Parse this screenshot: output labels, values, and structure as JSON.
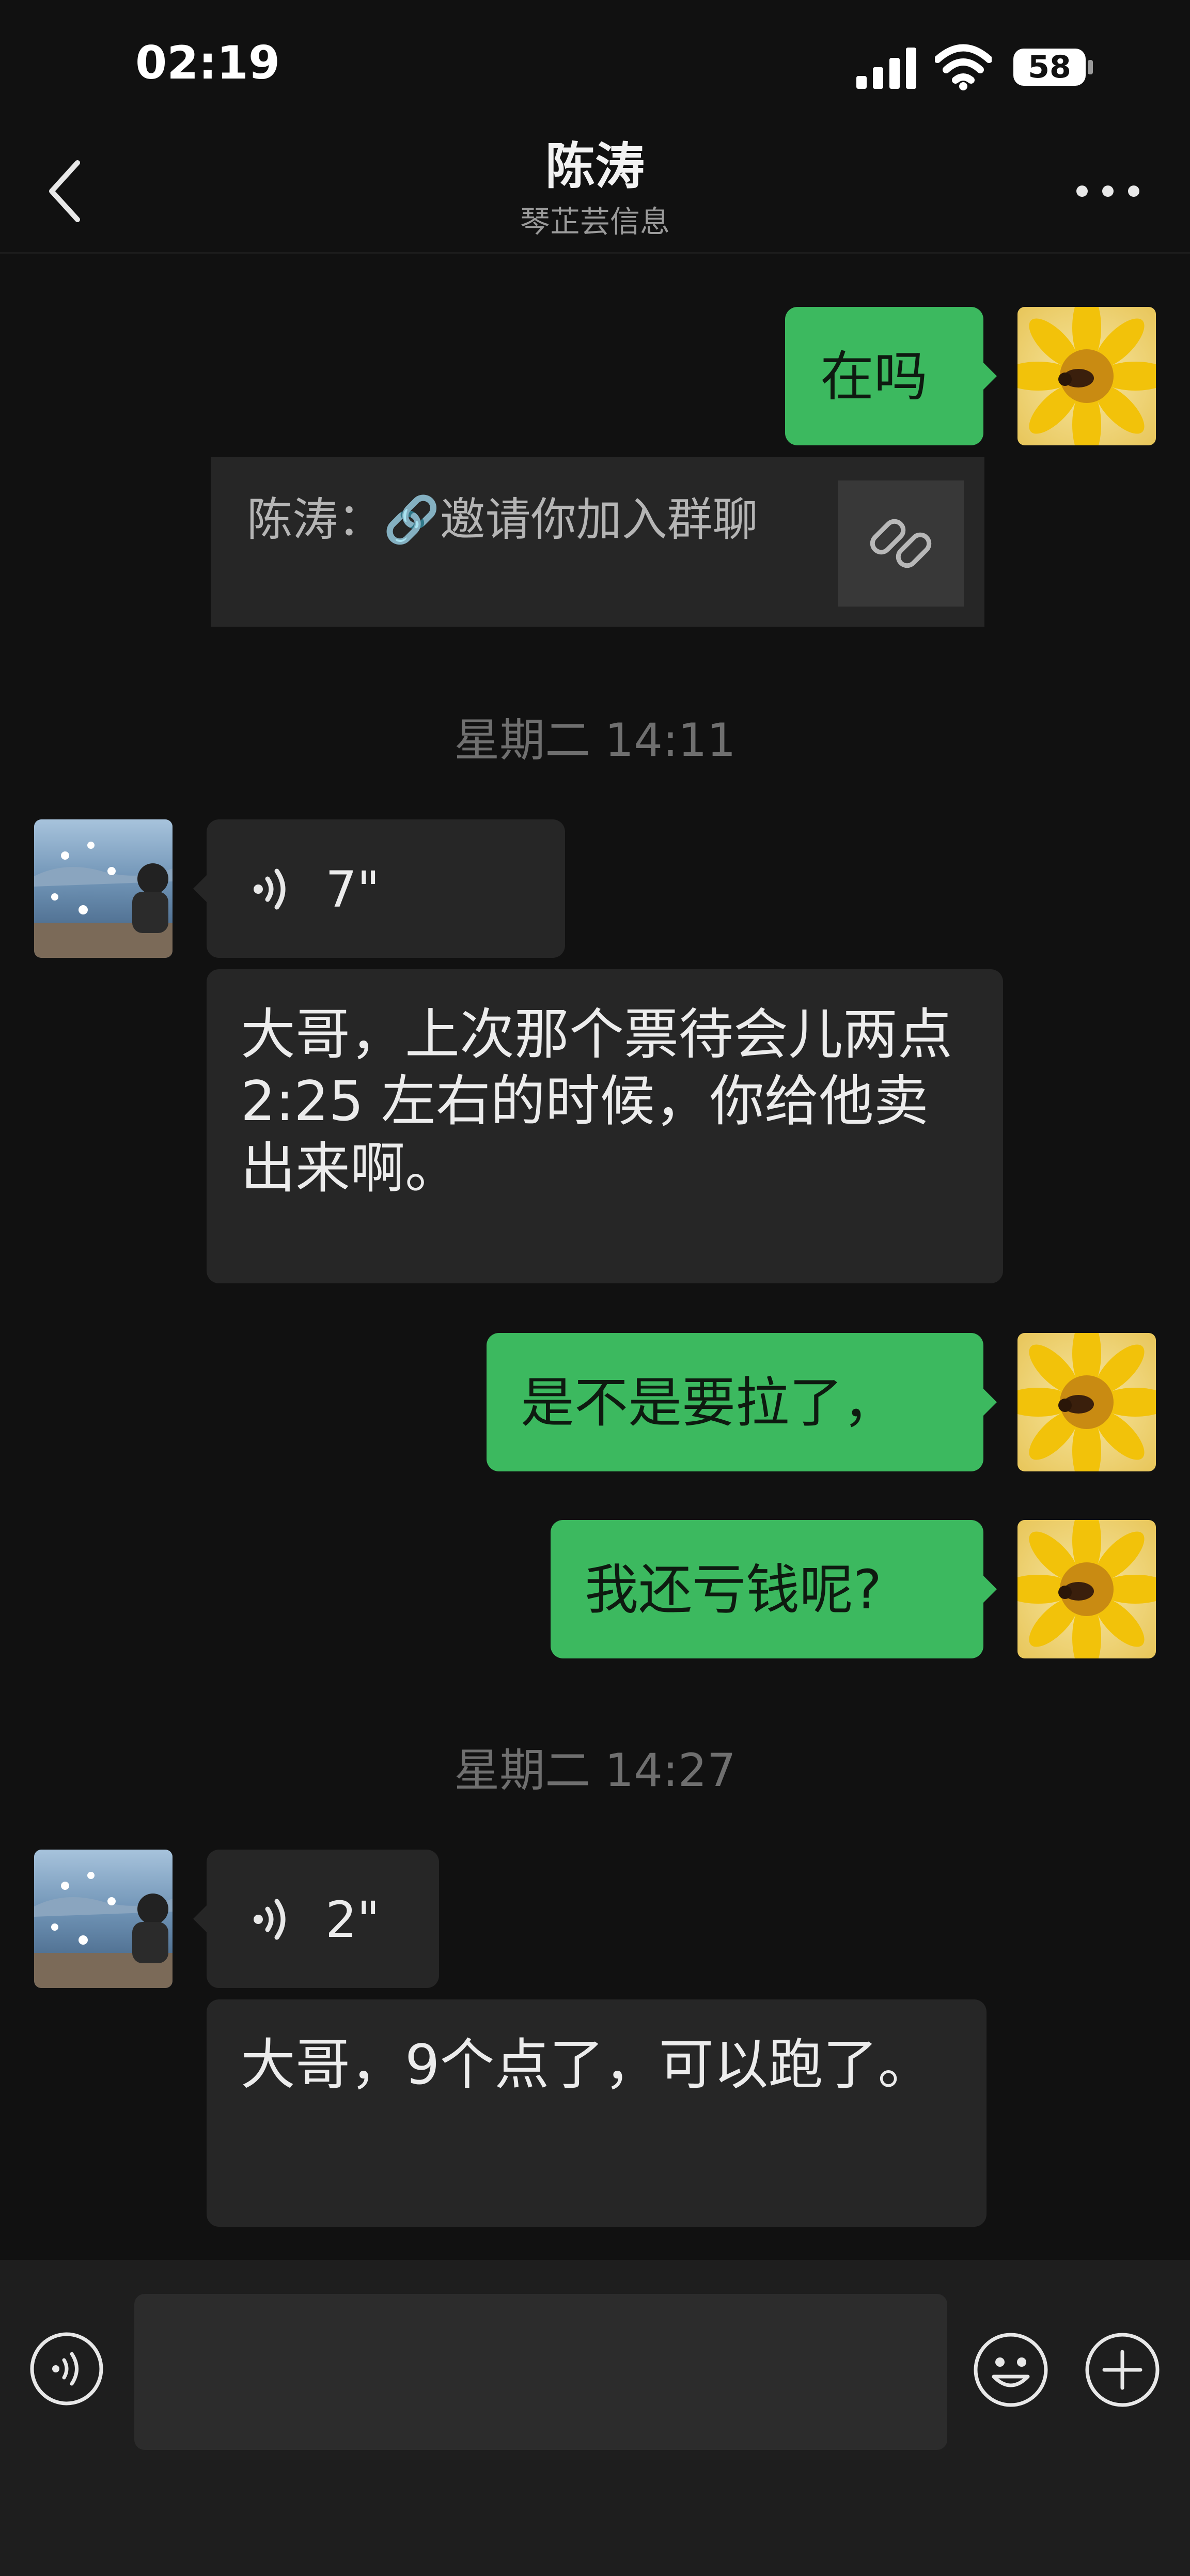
{
  "status_bar": {
    "time": "02:19",
    "battery_level": "58"
  },
  "header": {
    "name": "陈涛",
    "subtitle": "琴芷芸信息"
  },
  "messages": {
    "m1": {
      "text": "在吗"
    },
    "link": {
      "text": "陈涛：🔗邀请你加入群聊"
    },
    "ts1": {
      "text": "星期二 14:11"
    },
    "voice1": {
      "duration": "7\""
    },
    "m2": {
      "text": "大哥，上次那个票待会儿两点 2:25 左右的时候，你给他卖出来啊。"
    },
    "m3": {
      "text": "是不是要拉了，"
    },
    "m4": {
      "text": "我还亏钱呢?"
    },
    "ts2": {
      "text": "星期二 14:27"
    },
    "voice2": {
      "duration": "2\""
    },
    "m5": {
      "text": "大哥，9个点了，可以跑了。"
    }
  },
  "composer": {
    "placeholder": ""
  },
  "colors": {
    "accent_green": "#3cb95f",
    "background": "#111111",
    "bubble_dark": "#262626"
  },
  "icons": [
    "signal-icon",
    "wifi-icon",
    "battery-icon",
    "back-icon",
    "more-icon",
    "link-icon",
    "voice-wave-icon",
    "voice-input-icon",
    "emoji-icon",
    "plus-icon"
  ]
}
